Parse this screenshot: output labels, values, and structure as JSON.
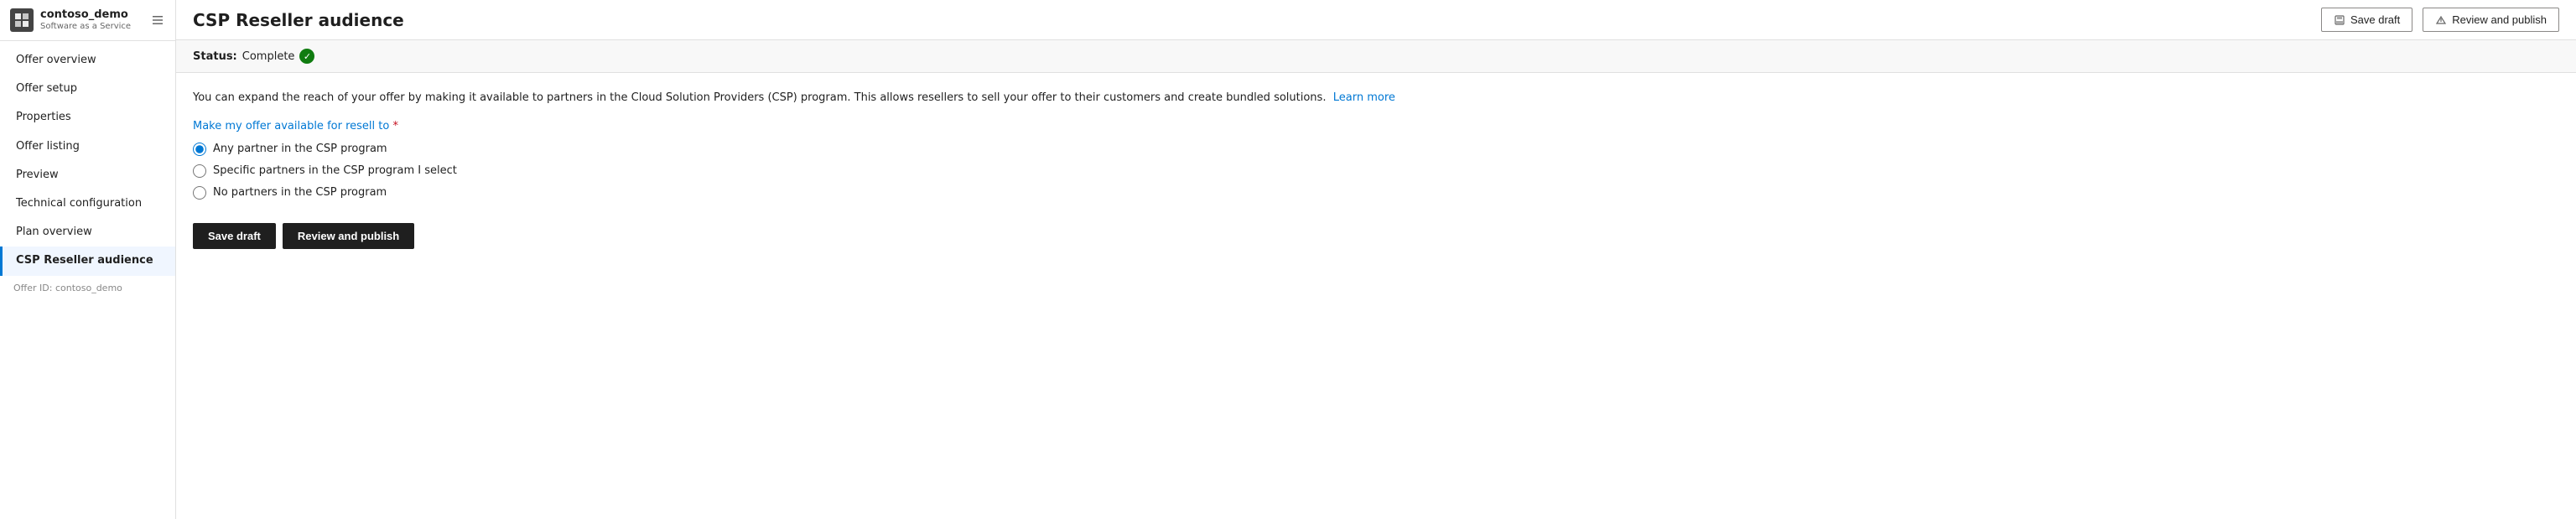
{
  "sidebar": {
    "app_name": "contoso_demo",
    "app_subtitle": "Software as a Service",
    "logo_text": "🏢",
    "items": [
      {
        "id": "offer-overview",
        "label": "Offer overview",
        "active": false
      },
      {
        "id": "offer-setup",
        "label": "Offer setup",
        "active": false
      },
      {
        "id": "properties",
        "label": "Properties",
        "active": false
      },
      {
        "id": "offer-listing",
        "label": "Offer listing",
        "active": false
      },
      {
        "id": "preview",
        "label": "Preview",
        "active": false
      },
      {
        "id": "technical-configuration",
        "label": "Technical configuration",
        "active": false
      },
      {
        "id": "plan-overview",
        "label": "Plan overview",
        "active": false
      },
      {
        "id": "csp-reseller-audience",
        "label": "CSP Reseller audience",
        "active": true
      }
    ],
    "offer_id_label": "Offer ID: contoso_demo"
  },
  "topbar": {
    "title": "CSP Reseller audience",
    "save_draft_label": "Save draft",
    "review_publish_label": "Review and publish"
  },
  "status": {
    "label": "Status:",
    "value": "Complete"
  },
  "content": {
    "description": "You can expand the reach of your offer by making it available to partners in the Cloud Solution Providers (CSP) program. This allows resellers to sell your offer to their customers and create bundled solutions.",
    "learn_more_label": "Learn more",
    "resell_label": "Make my offer available for resell to",
    "radio_options": [
      {
        "id": "any-partner",
        "label": "Any partner in the CSP program",
        "checked": true
      },
      {
        "id": "specific-partners",
        "label": "Specific partners in the CSP program I select",
        "checked": false
      },
      {
        "id": "no-partners",
        "label": "No partners in the CSP program",
        "checked": false
      }
    ],
    "save_draft_button": "Save draft",
    "review_publish_button": "Review and publish"
  }
}
